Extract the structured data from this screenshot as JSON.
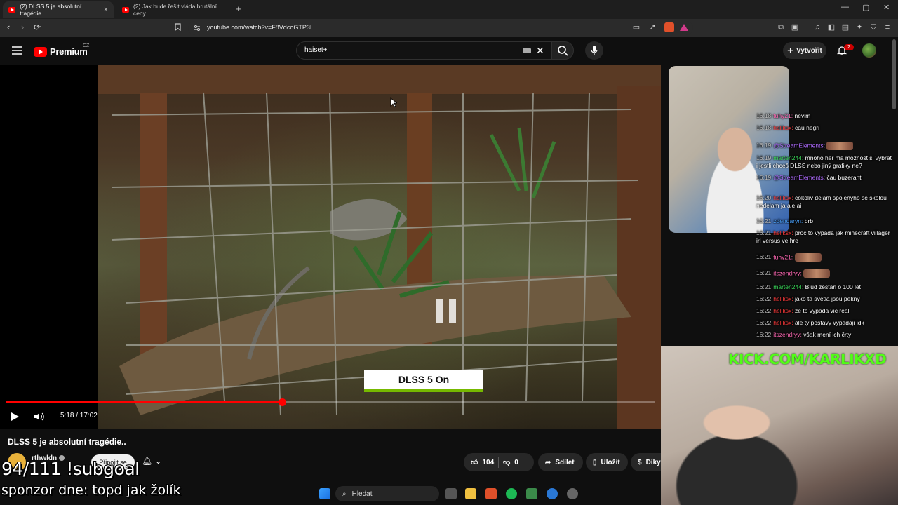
{
  "browser": {
    "tabs": [
      {
        "label": "(2) DLSS 5 je absolutní tragédie",
        "active": true
      },
      {
        "label": "(2) Jak bude řešit vláda brutální ceny",
        "active": false
      }
    ],
    "new_tab": "+",
    "url": "youtube.com/watch?v=F8VdcoGTP3I",
    "window_controls": {
      "minimize": "—",
      "maximize": "▢",
      "close": "✕"
    }
  },
  "youtube": {
    "logo_text": "Premium",
    "logo_region": "CZ",
    "search_value": "haiset+",
    "create_label": "Vytvořit",
    "notification_count": "2"
  },
  "video": {
    "time": "5:18 / 17:02",
    "progress": 0.425,
    "overlay_label": "DLSS 5 On",
    "overlay_accent": "#76b900"
  },
  "below_video": {
    "title": "DLSS 5 je absolutní tragédie..",
    "channel_name": "rthwldn",
    "join_label": "Připojit se",
    "like_count": "104",
    "dislike_count": "0",
    "share_label": "Sdílet",
    "save_label": "Uložit",
    "thanks_label": "Díky"
  },
  "stream_overlay": {
    "kick_url": "KICK.COM/KARLIKXD",
    "subgoal": "94/111 !subgoal",
    "sponsor": "sponzor dne: topd jak žolík"
  },
  "chat": [
    {
      "time": "16:18",
      "user": "tuhy21:",
      "user_color": "#ff69b4",
      "text": "nevim"
    },
    {
      "time": "16:18",
      "user": "heliksx:",
      "user_color": "#ff3b3b",
      "text": "cau negri"
    },
    {
      "time": "16:19",
      "user": "@StreamElements:",
      "user_color": "#b06cff",
      "text": "",
      "emote": true
    },
    {
      "time": "16:19",
      "user": "marten244:",
      "user_color": "#3bdc5b",
      "text": "mnoho her má možnost si vybrat i jestli chceš DLSS nebo jiný grafiky ne?"
    },
    {
      "time": "16:19",
      "user": "@StreamElements:",
      "user_color": "#b06cff",
      "text": "čau buzeranti"
    },
    {
      "time": "16:20",
      "user": "heliksx:",
      "user_color": "#ff3b3b",
      "text": "cokoliv delam spojenyho se skolou nedelam ja ale ai"
    },
    {
      "time": "16:21",
      "user": "zdendaryn:",
      "user_color": "#4aa3ff",
      "text": "brb"
    },
    {
      "time": "16:21",
      "user": "heliksx:",
      "user_color": "#ff3b3b",
      "text": "proc to vypada jak minecraft villager irl versus ve hre"
    },
    {
      "time": "16:21",
      "user": "tuhy21:",
      "user_color": "#ff69b4",
      "text": "",
      "emote": true
    },
    {
      "time": "16:21",
      "user": "itszendryy:",
      "user_color": "#ff69b4",
      "text": "",
      "emote": true
    },
    {
      "time": "16:21",
      "user": "marten244:",
      "user_color": "#3bdc5b",
      "text": "Blud zestárl o 100 let"
    },
    {
      "time": "16:22",
      "user": "heliksx:",
      "user_color": "#ff3b3b",
      "text": "jako ta svetla jsou pekny"
    },
    {
      "time": "16:22",
      "user": "heliksx:",
      "user_color": "#ff3b3b",
      "text": "ze to vypada vic real"
    },
    {
      "time": "16:22",
      "user": "heliksx:",
      "user_color": "#ff3b3b",
      "text": "ale ty postavy vypadaji idk"
    },
    {
      "time": "16:22",
      "user": "itszendryy:",
      "user_color": "#ff69b4",
      "text": "však mení ich črty"
    }
  ],
  "taskbar": {
    "search_label": "Hledat"
  }
}
